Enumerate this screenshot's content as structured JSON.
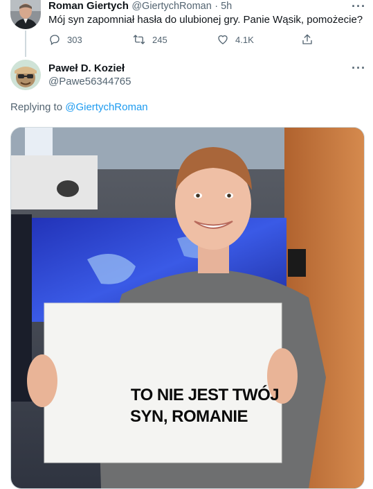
{
  "tweet": {
    "author_name": "Roman Giertych",
    "author_handle": "@GiertychRoman",
    "time": "· 5h",
    "text": "Mój syn zapomniał hasła do ulubionej gry. Panie Wąsik, pomożecie?",
    "replies": "303",
    "retweets": "245",
    "likes": "4.1K",
    "more": "···"
  },
  "reply": {
    "author_name": "Paweł D. Kozieł",
    "author_handle": "@Pawe56344765",
    "replying_label": "Replying to",
    "replying_to": "@GiertychRoman",
    "more": "···",
    "image_caption_line1": "TO NIE JEST TWÓJ",
    "image_caption_line2": "SYN, ROMANIE"
  },
  "colors": {
    "link": "#1d9bf0",
    "muted": "#536471",
    "divider": "#cfd9de"
  },
  "icons": [
    "reply-icon",
    "retweet-icon",
    "like-icon",
    "share-icon",
    "more-icon"
  ]
}
